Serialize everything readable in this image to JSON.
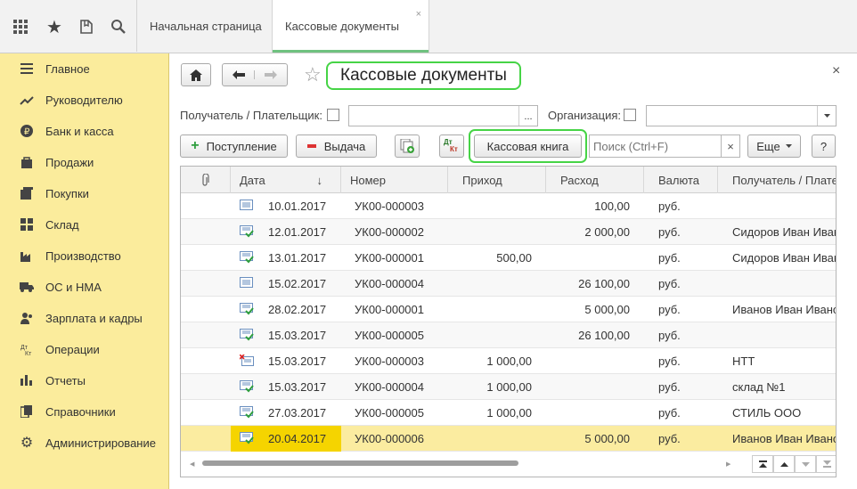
{
  "topbar": {
    "tabs": [
      {
        "label": "Начальная страница"
      },
      {
        "label": "Кассовые документы",
        "close": "×"
      }
    ]
  },
  "sidebar": {
    "items": [
      {
        "label": "Главное",
        "icon": "menu-icon"
      },
      {
        "label": "Руководителю",
        "icon": "trend-icon"
      },
      {
        "label": "Банк и касса",
        "icon": "coin-icon"
      },
      {
        "label": "Продажи",
        "icon": "bag-icon"
      },
      {
        "label": "Покупки",
        "icon": "cart-icon"
      },
      {
        "label": "Склад",
        "icon": "warehouse-icon"
      },
      {
        "label": "Производство",
        "icon": "factory-icon"
      },
      {
        "label": "ОС и НМА",
        "icon": "truck-icon"
      },
      {
        "label": "Зарплата и кадры",
        "icon": "people-icon"
      },
      {
        "label": "Операции",
        "icon": "dt-kt-icon"
      },
      {
        "label": "Отчеты",
        "icon": "bar-chart-icon"
      },
      {
        "label": "Справочники",
        "icon": "books-icon"
      },
      {
        "label": "Администрирование",
        "icon": "gear-icon"
      }
    ]
  },
  "form": {
    "title": "Кассовые документы",
    "close": "×",
    "recipient_label": "Получатель / Плательщик:",
    "org_label": "Организация:",
    "ellipsis": "...",
    "receipt_btn": "Поступление",
    "issue_btn": "Выдача",
    "cashbook_btn": "Кассовая книга",
    "search_placeholder": "Поиск (Ctrl+F)",
    "clear": "×",
    "more_btn": "Еще",
    "help_btn": "?",
    "dtkt_dt": "Дт",
    "dtkt_kt": "Кт"
  },
  "table": {
    "columns": [
      "Дата",
      "Номер",
      "Приход",
      "Расход",
      "Валюта",
      "Получатель / Плате"
    ],
    "sort_arrow": "↓",
    "rows": [
      {
        "status": "draft",
        "date": "10.01.2017",
        "number": "УК00-000003",
        "income": "",
        "expense": "100,00",
        "currency": "руб.",
        "recipient": ""
      },
      {
        "status": "posted",
        "date": "12.01.2017",
        "number": "УК00-000002",
        "income": "",
        "expense": "2 000,00",
        "currency": "руб.",
        "recipient": "Сидоров Иван Иван"
      },
      {
        "status": "posted",
        "date": "13.01.2017",
        "number": "УК00-000001",
        "income": "500,00",
        "expense": "",
        "currency": "руб.",
        "recipient": "Сидоров Иван Иван"
      },
      {
        "status": "draft",
        "date": "15.02.2017",
        "number": "УК00-000004",
        "income": "",
        "expense": "26 100,00",
        "currency": "руб.",
        "recipient": ""
      },
      {
        "status": "posted",
        "date": "28.02.2017",
        "number": "УК00-000001",
        "income": "",
        "expense": "5 000,00",
        "currency": "руб.",
        "recipient": "Иванов Иван Ивано"
      },
      {
        "status": "posted",
        "date": "15.03.2017",
        "number": "УК00-000005",
        "income": "",
        "expense": "26 100,00",
        "currency": "руб.",
        "recipient": ""
      },
      {
        "status": "deleted",
        "date": "15.03.2017",
        "number": "УК00-000003",
        "income": "1 000,00",
        "expense": "",
        "currency": "руб.",
        "recipient": "НТТ"
      },
      {
        "status": "posted",
        "date": "15.03.2017",
        "number": "УК00-000004",
        "income": "1 000,00",
        "expense": "",
        "currency": "руб.",
        "recipient": "склад №1"
      },
      {
        "status": "posted",
        "date": "27.03.2017",
        "number": "УК00-000005",
        "income": "1 000,00",
        "expense": "",
        "currency": "руб.",
        "recipient": "СТИЛЬ ООО"
      },
      {
        "status": "posted",
        "date": "20.04.2017",
        "number": "УК00-000006",
        "income": "",
        "expense": "5 000,00",
        "currency": "руб.",
        "recipient": "Иванов Иван Ивано",
        "selected": true
      }
    ]
  },
  "colors": {
    "accent_green": "#46d446",
    "sidebar_bg": "#fbec9c",
    "selected_row": "#fbeca0",
    "selected_date": "#f5d400"
  }
}
